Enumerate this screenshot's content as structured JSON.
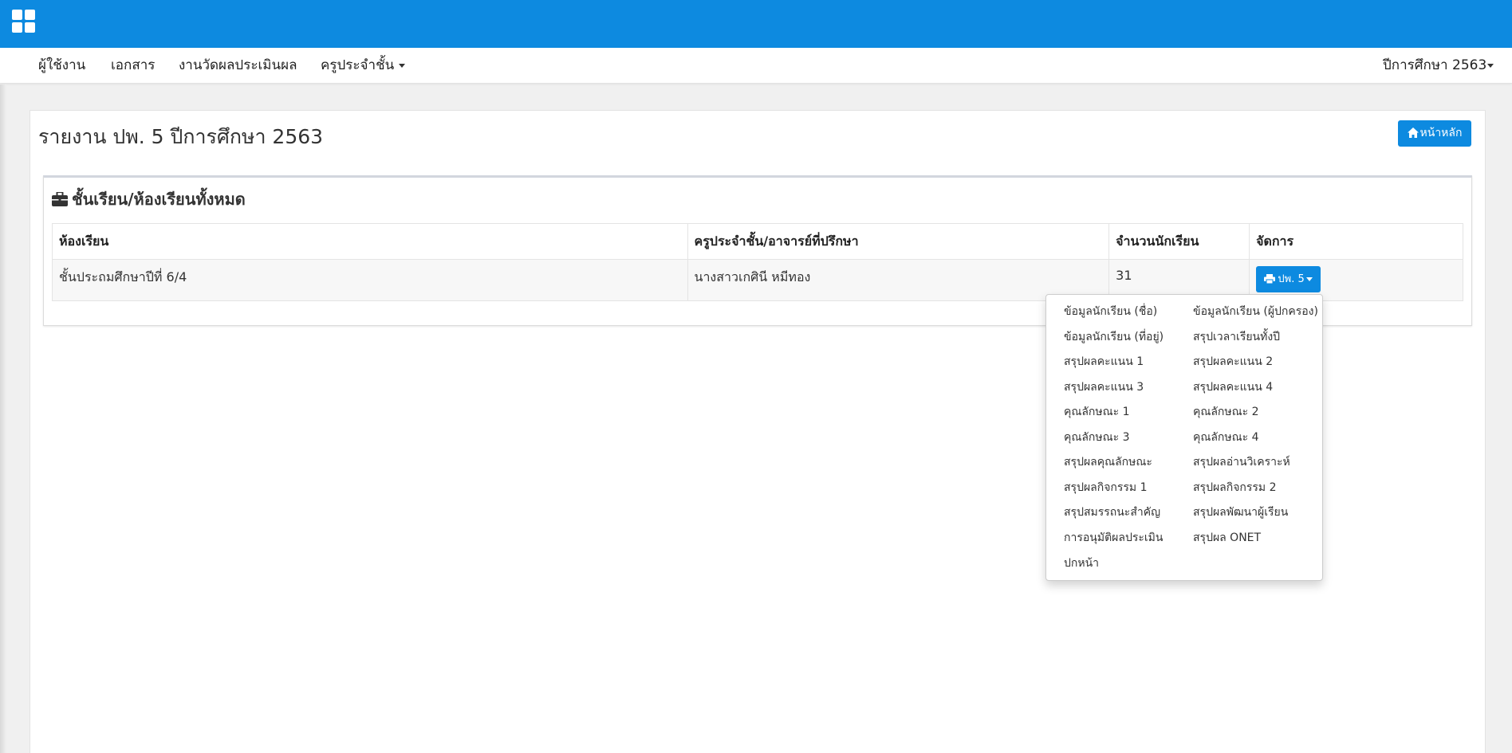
{
  "navbar": {
    "items": [
      "ผู้ใช้งาน",
      "เอกสาร",
      "งานวัดผลประเมินผล",
      "ครูประจำชั้น"
    ],
    "year_menu": "ปีการศึกษา 2563"
  },
  "page": {
    "title": "รายงาน ปพ. 5 ปีการศึกษา 2563",
    "home_button": "หน้าหลัก"
  },
  "panel": {
    "title": "ชั้นเรียน/ห้องเรียนทั้งหมด",
    "columns": [
      "ห้องเรียน",
      "ครูประจำชั้น/อาจารย์ที่ปรึกษา",
      "จำนวนนักเรียน",
      "จัดการ"
    ],
    "rows": [
      {
        "room": "ชั้นประถมศึกษาปีที่ 6/4",
        "teacher": "นางสาวเกศินี หมีทอง",
        "students": "31",
        "action": "ปพ. 5"
      }
    ]
  },
  "dropdown": {
    "items": [
      "ข้อมูลนักเรียน (ชื่อ)",
      "ข้อมูลนักเรียน (ผู้ปกครอง)",
      "ข้อมูลนักเรียน (ที่อยู่)",
      "สรุปเวลาเรียนทั้งปี",
      "สรุปผลคะแนน 1",
      "สรุปผลคะแนน 2",
      "สรุปผลคะแนน 3",
      "สรุปผลคะแนน 4",
      "คุณลักษณะ 1",
      "คุณลักษณะ 2",
      "คุณลักษณะ 3",
      "คุณลักษณะ 4",
      "สรุปผลคุณลักษณะ",
      "สรุปผลอ่านวิเคราะห์",
      "สรุปผลกิจกรรม 1",
      "สรุปผลกิจกรรม 2",
      "สรุปสมรรถนะสำคัญ",
      "สรุปผลพัฒนาผู้เรียน",
      "การอนุมัติผลประเมิน",
      "สรุปผล ONET",
      "ปกหน้า"
    ]
  },
  "colors": {
    "primary": "#0d8ae0",
    "background": "#f0f0f0"
  },
  "icons": [
    "grid-icon",
    "home-icon",
    "briefcase-icon",
    "printer-icon"
  ]
}
